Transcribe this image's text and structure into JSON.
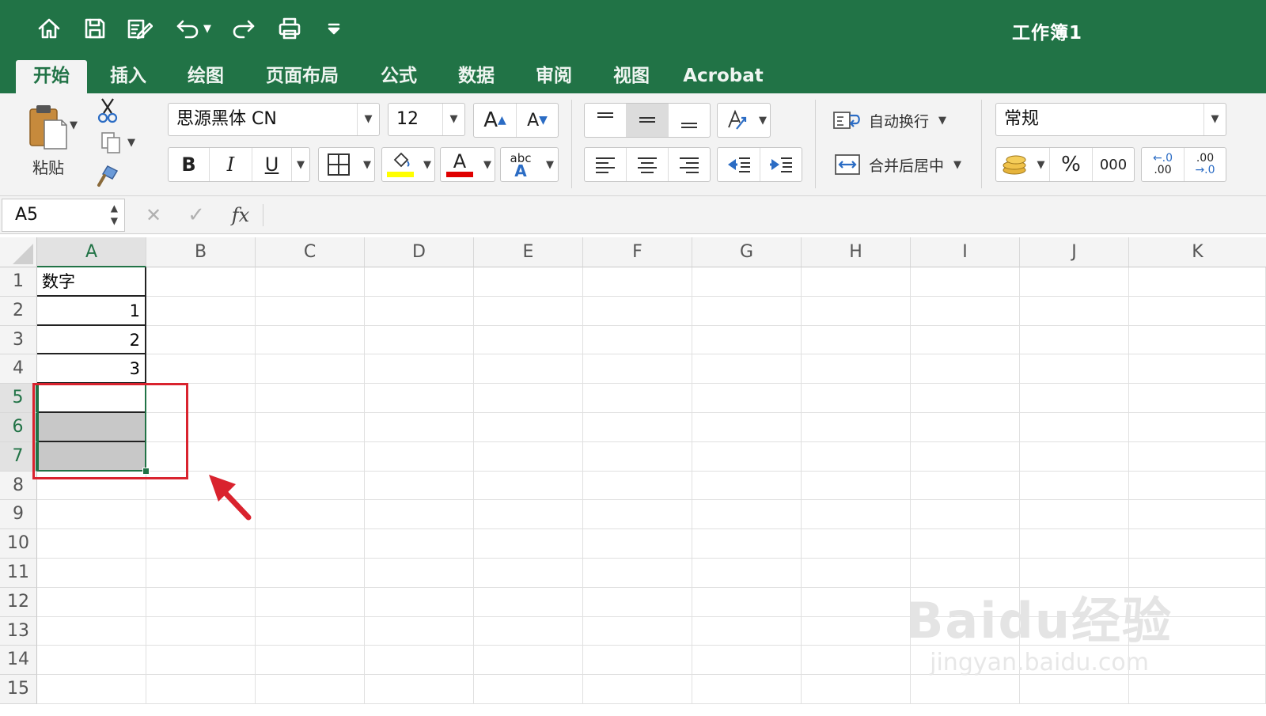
{
  "app": {
    "workbook_title": "工作簿1"
  },
  "colors": {
    "brand": "#217346",
    "annotation": "#d9232e",
    "selection_fill": "#c8c8c8"
  },
  "quick_access": [
    "home-icon",
    "save-icon",
    "edit-icon",
    "undo-icon",
    "redo-icon",
    "print-icon",
    "customize-icon"
  ],
  "tabs": [
    {
      "label": "开始",
      "active": true
    },
    {
      "label": "插入"
    },
    {
      "label": "绘图"
    },
    {
      "label": "页面布局"
    },
    {
      "label": "公式"
    },
    {
      "label": "数据"
    },
    {
      "label": "审阅"
    },
    {
      "label": "视图"
    },
    {
      "label": "Acrobat"
    }
  ],
  "ribbon": {
    "paste_label": "粘贴",
    "font_name": "思源黑体 CN",
    "font_size": "12",
    "bold": "B",
    "italic": "I",
    "underline": "U",
    "font_color_glyph": "A",
    "grow_font": "A",
    "shrink_font": "A",
    "abc_label": "abc",
    "abc_a": "A",
    "wrap_text": "自动换行",
    "merge_center": "合并后居中",
    "number_format": "常规",
    "percent": "%",
    "thousands": "000",
    "inc_decimal_top": "←.0",
    "inc_decimal_bottom": ".00",
    "dec_decimal_top": ".00",
    "dec_decimal_bottom": "→.0"
  },
  "formula_bar": {
    "name_box": "A5",
    "cancel": "✕",
    "enter": "✓",
    "fx": "fx",
    "content": ""
  },
  "sheet": {
    "columns": [
      "A",
      "B",
      "C",
      "D",
      "E",
      "F",
      "G",
      "H",
      "I",
      "J",
      "K"
    ],
    "rows": [
      "1",
      "2",
      "3",
      "4",
      "5",
      "6",
      "7",
      "8",
      "9",
      "10",
      "11",
      "12",
      "13",
      "14",
      "15"
    ],
    "selected_column": "A",
    "selected_rows": [
      "5",
      "6",
      "7"
    ],
    "active_cell": "A5",
    "cells": {
      "A1": "数字",
      "A2": "1",
      "A3": "2",
      "A4": "3"
    }
  },
  "watermark": {
    "line1": "Baidu经验",
    "line2": "jingyan.baidu.com"
  }
}
